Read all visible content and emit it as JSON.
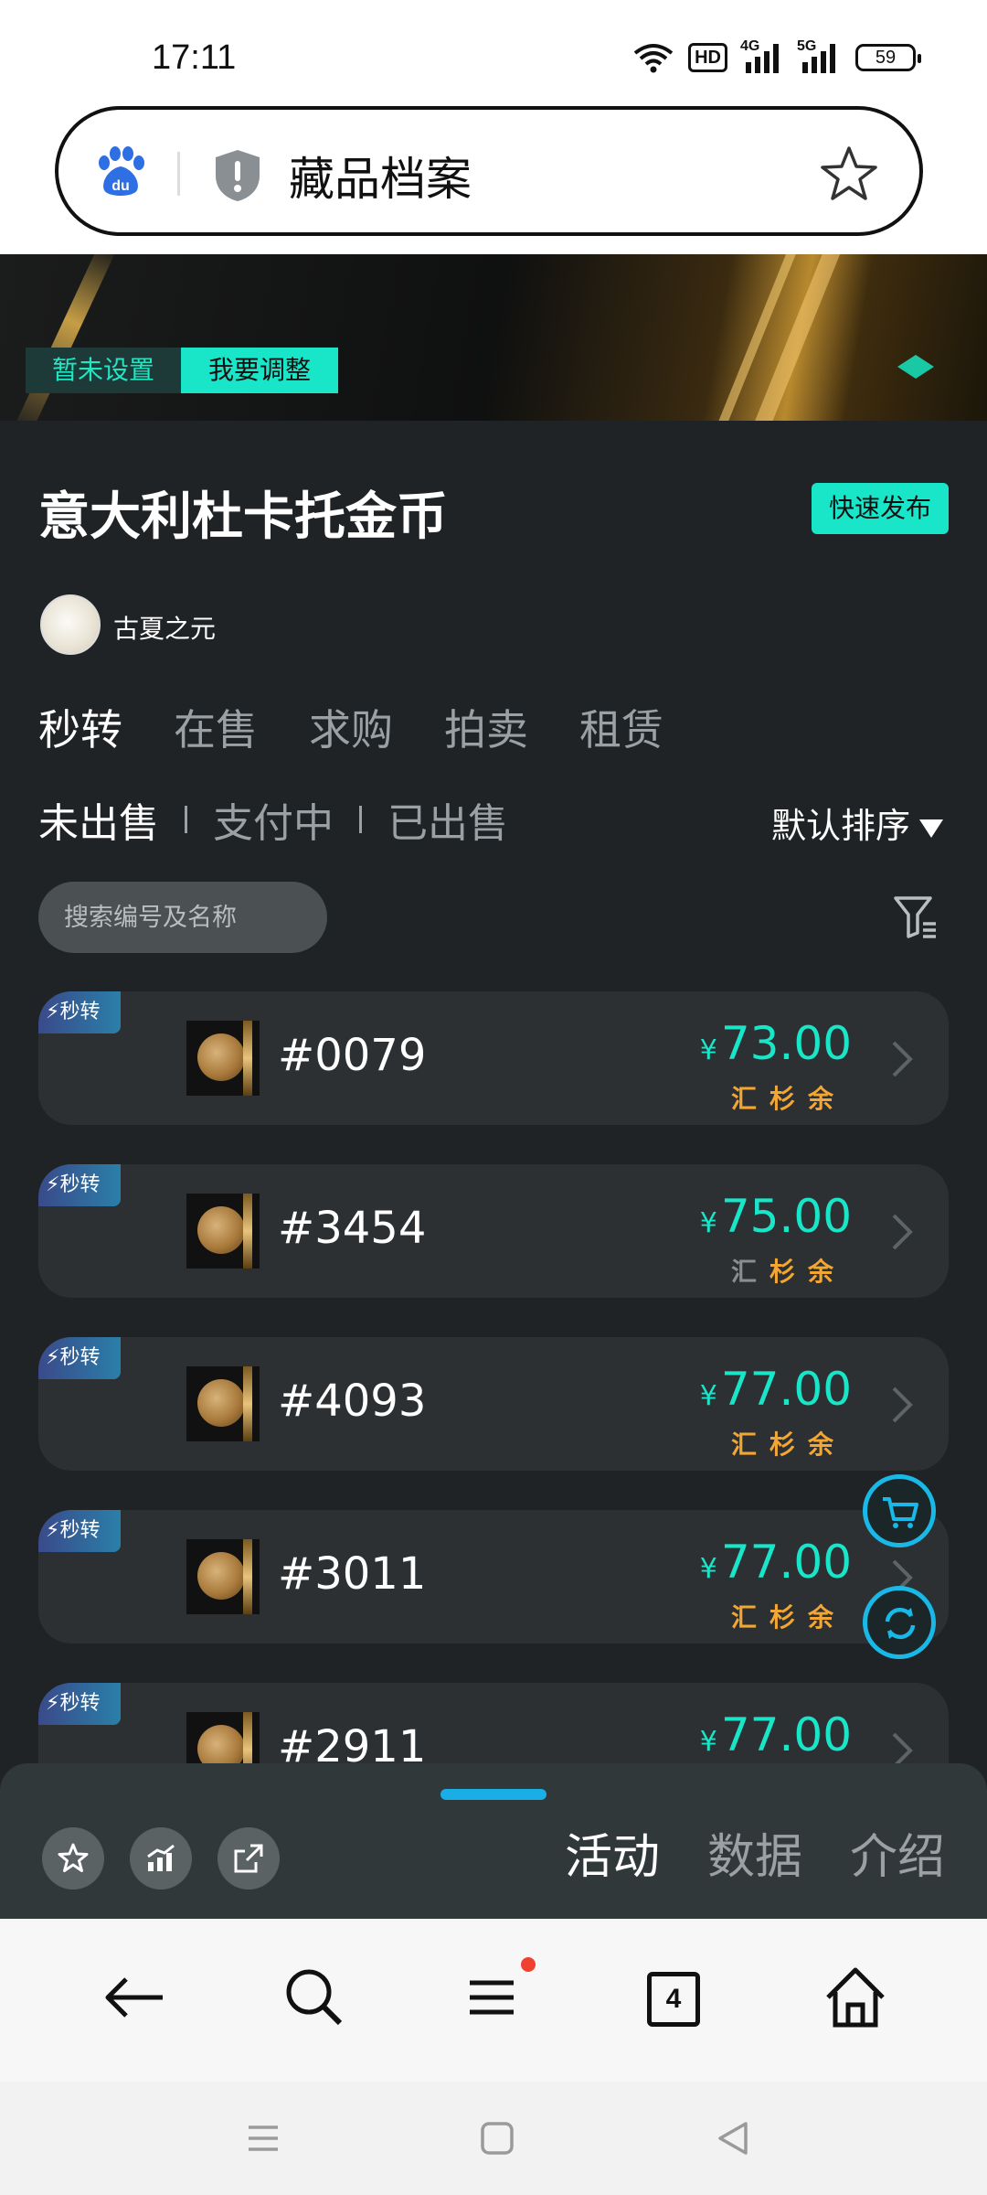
{
  "status_bar": {
    "time": "17:11",
    "hd": "HD",
    "net1": "4G",
    "net2": "5G",
    "battery": "59"
  },
  "browser": {
    "page_title": "藏品档案",
    "tab_count": "4"
  },
  "banner": {
    "unset_label": "暂未设置",
    "adjust_label": "我要调整"
  },
  "collection": {
    "title": "意大利杜卡托金币",
    "quick_publish": "快速发布",
    "author": "古夏之元"
  },
  "tabs": [
    "秒转",
    "在售",
    "求购",
    "拍卖",
    "租赁"
  ],
  "subtabs": [
    "未出售",
    "支付中",
    "已出售"
  ],
  "sort_label": "默认排序",
  "search": {
    "placeholder": "搜索编号及名称"
  },
  "items": [
    {
      "badge": "秒转",
      "number": "#0079",
      "currency": "¥",
      "price": "73.00",
      "tags": [
        "汇",
        "杉",
        "余"
      ],
      "tags_dim": [
        false,
        false,
        false
      ]
    },
    {
      "badge": "秒转",
      "number": "#3454",
      "currency": "¥",
      "price": "75.00",
      "tags": [
        "汇",
        "杉",
        "余"
      ],
      "tags_dim": [
        true,
        false,
        false
      ]
    },
    {
      "badge": "秒转",
      "number": "#4093",
      "currency": "¥",
      "price": "77.00",
      "tags": [
        "汇",
        "杉",
        "余"
      ],
      "tags_dim": [
        false,
        false,
        false
      ]
    },
    {
      "badge": "秒转",
      "number": "#3011",
      "currency": "¥",
      "price": "77.00",
      "tags": [
        "汇",
        "杉",
        "余"
      ],
      "tags_dim": [
        false,
        false,
        false
      ]
    },
    {
      "badge": "秒转",
      "number": "#2911",
      "currency": "¥",
      "price": "77.00",
      "tags": [],
      "tags_dim": []
    }
  ],
  "sheet_tabs": [
    "活动",
    "数据",
    "介绍"
  ],
  "colors": {
    "accent": "#19e6c9",
    "price": "#19e6c9",
    "tag": "#f3a632",
    "bg": "#1f2325"
  }
}
